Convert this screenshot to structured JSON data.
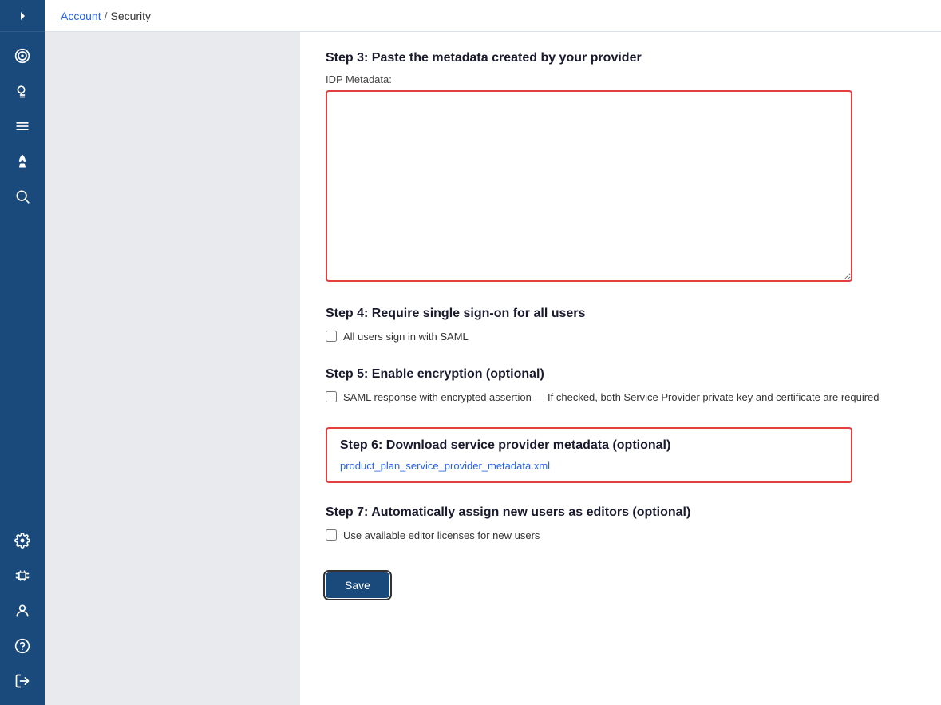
{
  "breadcrumb": {
    "account": "Account",
    "separator": "/",
    "current": "Security"
  },
  "sidebar": {
    "toggle_title": "Toggle sidebar",
    "icons": [
      {
        "name": "target-icon",
        "symbol": "⊙"
      },
      {
        "name": "lightbulb-icon",
        "symbol": "💡"
      },
      {
        "name": "menu-icon",
        "symbol": "☰"
      },
      {
        "name": "rocket-icon",
        "symbol": "🚀"
      },
      {
        "name": "search-icon",
        "symbol": "🔍"
      }
    ],
    "bottom_icons": [
      {
        "name": "gear-icon",
        "symbol": "⚙"
      },
      {
        "name": "plugin-icon",
        "symbol": "🔌"
      },
      {
        "name": "user-icon",
        "symbol": "👤"
      },
      {
        "name": "help-icon",
        "symbol": "❓"
      },
      {
        "name": "logout-icon",
        "symbol": "↪"
      }
    ]
  },
  "steps": {
    "step3": {
      "title": "Step 3: Paste the metadata created by your provider",
      "label": "IDP Metadata:",
      "textarea_placeholder": ""
    },
    "step4": {
      "title": "Step 4: Require single sign-on for all users",
      "checkbox_label": "All users sign in with SAML",
      "checked": false
    },
    "step5": {
      "title": "Step 5: Enable encryption (optional)",
      "checkbox_label": "SAML response with encrypted assertion — If checked, both Service Provider private key and certificate are required",
      "checked": false
    },
    "step6": {
      "title": "Step 6: Download service provider metadata (optional)",
      "link_text": "product_plan_service_provider_metadata.xml"
    },
    "step7": {
      "title": "Step 7: Automatically assign new users as editors (optional)",
      "checkbox_label": "Use available editor licenses for new users",
      "checked": false
    }
  },
  "buttons": {
    "save": "Save"
  }
}
